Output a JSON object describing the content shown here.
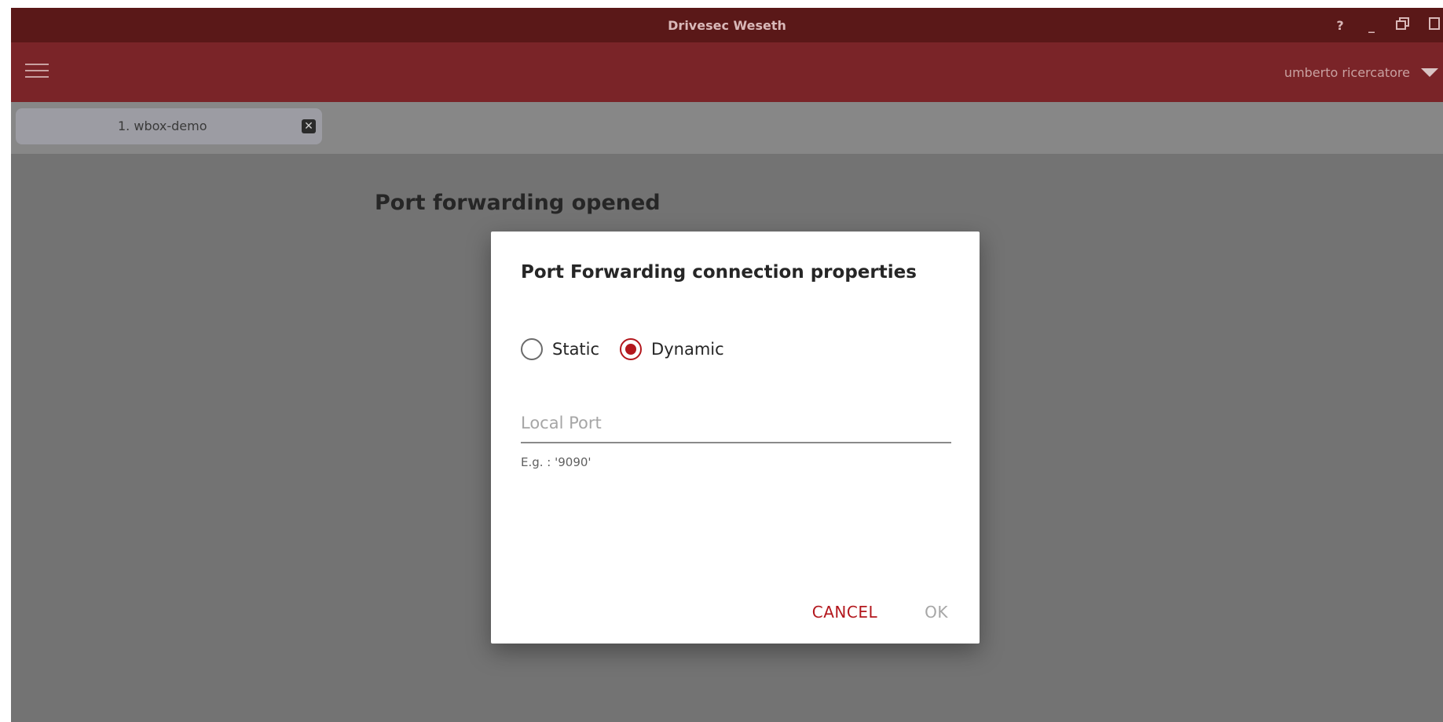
{
  "window": {
    "title": "Drivesec Weseth",
    "controls": {
      "help": "?",
      "minimize": "_"
    }
  },
  "toolbar": {
    "user_name": "umberto ricercatore"
  },
  "tabs": [
    {
      "label": "1. wbox-demo",
      "close": "✕"
    }
  ],
  "page": {
    "heading": "Port forwarding opened"
  },
  "dialog": {
    "title": "Port Forwarding connection properties",
    "mode_options": [
      {
        "label": "Static",
        "checked": false
      },
      {
        "label": "Dynamic",
        "checked": true
      }
    ],
    "local_port": {
      "placeholder": "Local Port",
      "value": "",
      "hint": "E.g. : '9090'"
    },
    "buttons": {
      "cancel": "CANCEL",
      "ok": "OK"
    }
  },
  "colors": {
    "titlebar": "#5a1818",
    "toolbar": "#7a2428",
    "accent": "#b3171d",
    "overlay": "#737373"
  }
}
